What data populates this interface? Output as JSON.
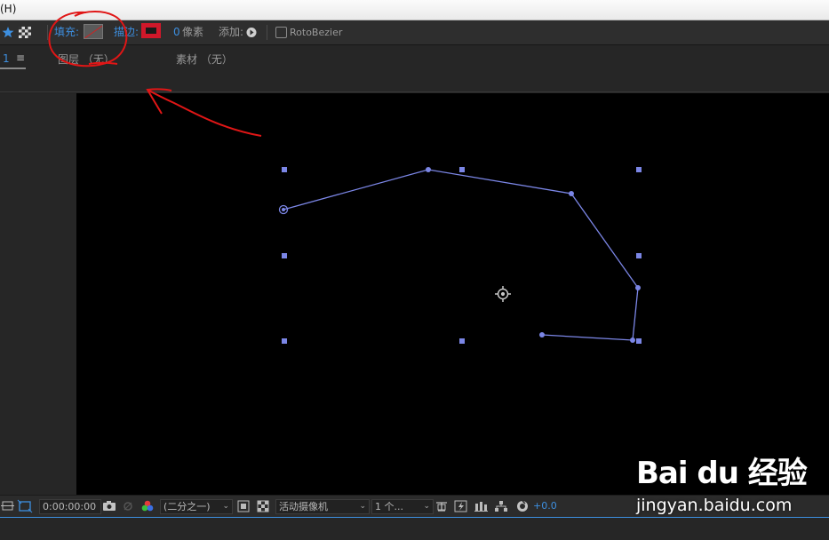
{
  "menubar": {
    "fragment": "(H)"
  },
  "toolbar": {
    "fill_label": "填充:",
    "stroke_label": "描边:",
    "stroke_width": "0",
    "stroke_unit": "像素",
    "add_label": "添加:",
    "rotobezier_label": "RotoBezier",
    "fill_color": "#5a5a5a",
    "stroke_color": "#d0182a"
  },
  "tabs": {
    "number": "1",
    "menu_icon": "≡",
    "layer": "图层 （无）",
    "footage": "素材 （无）"
  },
  "statusbar": {
    "timecode": "0:00:00:00",
    "resolution": "(二分之一)",
    "camera": "活动摄像机",
    "views": "1 个...",
    "exposure": "+0.0"
  },
  "watermark": {
    "logo": "Bai du 经验",
    "url": "jingyan.baidu.com"
  },
  "colors": {
    "accent": "#3d8fe0",
    "path": "#7b86e6",
    "annotation": "#e01616"
  }
}
